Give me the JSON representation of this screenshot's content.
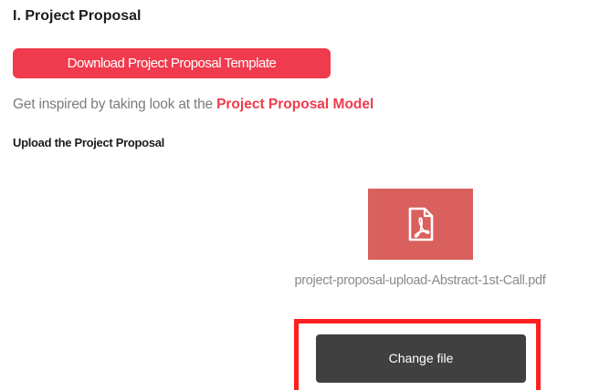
{
  "section": {
    "title": "I. Project Proposal"
  },
  "template": {
    "download_label": "Download Project Proposal Template"
  },
  "inspiration": {
    "prefix": "Get inspired by taking look at the",
    "link_label": "Project Proposal Model"
  },
  "upload": {
    "label": "Upload the Project Proposal",
    "file_icon": "pdf-file-icon",
    "file_name": "project-proposal-upload-Abstract-1st-Call.pdf",
    "change_label": "Change file"
  },
  "colors": {
    "accent": "#ef3b4d",
    "pdf_tile": "#d9605d",
    "change_button": "#404040",
    "highlight": "#ff1f1f"
  }
}
